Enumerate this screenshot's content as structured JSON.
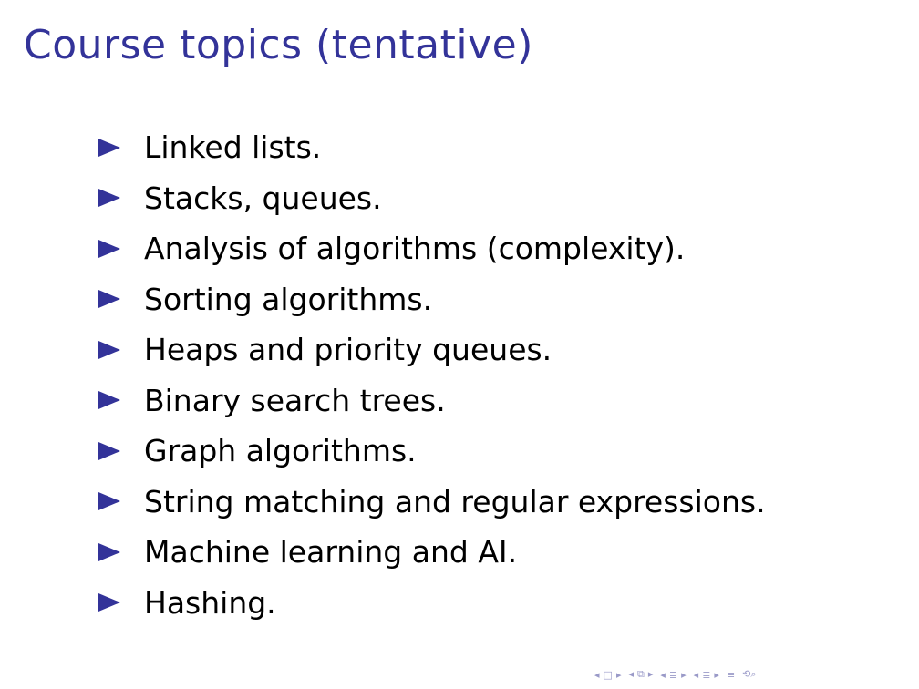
{
  "slide": {
    "title": "Course topics (tentative)",
    "accent_color": "#333399",
    "bullet_icon": "triangle-right-icon",
    "topics": [
      "Linked lists.",
      "Stacks, queues.",
      "Analysis of algorithms (complexity).",
      "Sorting algorithms.",
      "Heaps and priority queues.",
      "Binary search trees.",
      "Graph algorithms.",
      "String matching and regular expressions.",
      "Machine learning and AI.",
      "Hashing."
    ]
  },
  "navigation": {
    "icons": [
      "nav-frame-prev-icon",
      "nav-frame-icon",
      "nav-frame-next-icon",
      "nav-subsection-prev-icon",
      "nav-subsection-icon",
      "nav-subsection-next-icon",
      "nav-section-prev-icon",
      "nav-section-icon",
      "nav-section-next-icon",
      "nav-doc-prev-icon",
      "nav-doc-icon",
      "nav-doc-next-icon",
      "nav-align-icon",
      "nav-search-icon"
    ]
  }
}
